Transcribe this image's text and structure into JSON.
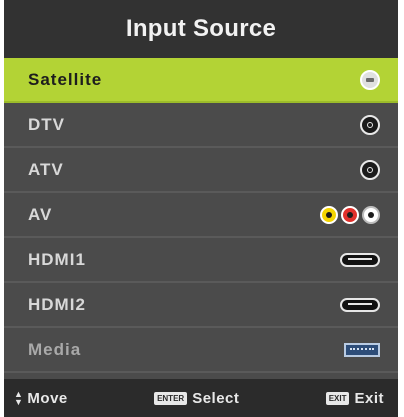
{
  "menu": {
    "title": "Input Source",
    "items": [
      {
        "label": "Satellite",
        "icon": "satellite-coax-icon",
        "selected": true
      },
      {
        "label": "DTV",
        "icon": "coax-icon",
        "selected": false
      },
      {
        "label": "ATV",
        "icon": "coax-icon",
        "selected": false
      },
      {
        "label": "AV",
        "icon": "rca-av-icon",
        "selected": false
      },
      {
        "label": "HDMI1",
        "icon": "hdmi-port-icon",
        "selected": false
      },
      {
        "label": "HDMI2",
        "icon": "hdmi-port-icon",
        "selected": false
      },
      {
        "label": "Media",
        "icon": "usb-port-icon",
        "selected": false
      }
    ]
  },
  "footer": {
    "move_label": "Move",
    "enter_key": "ENTER",
    "select_label": "Select",
    "exit_key": "EXIT",
    "exit_label": "Exit"
  },
  "colors": {
    "highlight": "#b3d335",
    "panel": "#4b4b4b",
    "title_bar": "#323232",
    "av_yellow": "#f4d500",
    "av_red": "#e0302b",
    "av_white": "#ffffff"
  }
}
